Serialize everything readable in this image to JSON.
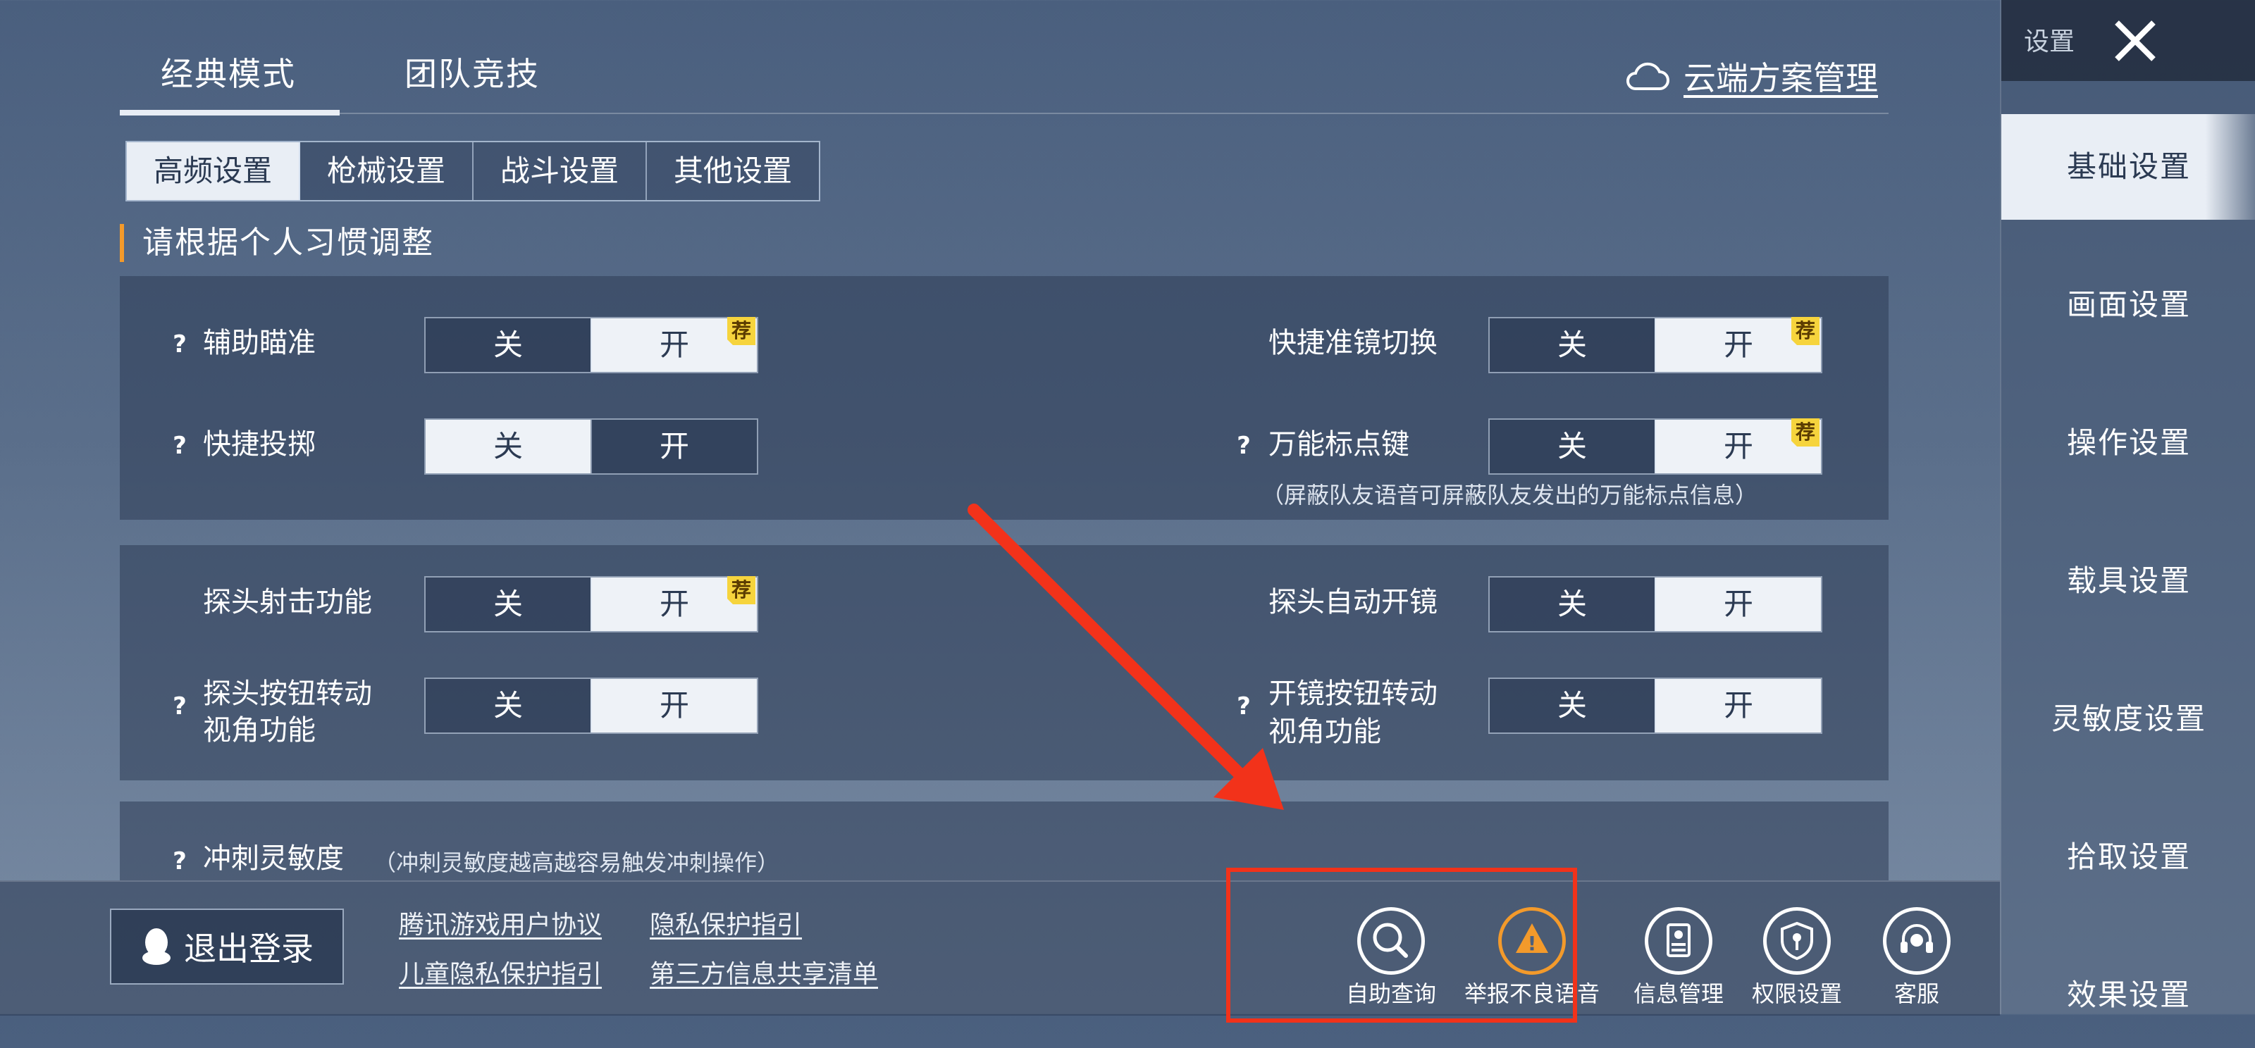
{
  "mode_tabs": [
    "经典模式",
    "团队竞技"
  ],
  "cloud_label": "云端方案管理",
  "sub_tabs": [
    "高频设置",
    "枪械设置",
    "战斗设置",
    "其他设置"
  ],
  "section_title": "请根据个人习惯调整",
  "toggle": {
    "off": "关",
    "on": "开",
    "recommended": "荐"
  },
  "settings": {
    "aim_assist": {
      "label": "辅助瞄准",
      "value": "开"
    },
    "quick_scope_switch": {
      "label": "快捷准镜切换",
      "value": "开"
    },
    "quick_throw": {
      "label": "快捷投掷",
      "value": "关"
    },
    "universal_marker": {
      "label": "万能标点键",
      "value": "开",
      "note": "（屏蔽队友语音可屏蔽队友发出的万能标点信息）"
    },
    "peek_fire": {
      "label": "探头射击功能",
      "value": "开"
    },
    "peek_auto_scope": {
      "label": "探头自动开镜",
      "value": "开"
    },
    "peek_button_rotate": {
      "label_line1": "探头按钮转动",
      "label_line2": "视角功能",
      "value": "开"
    },
    "scope_button_rotate": {
      "label_line1": "开镜按钮转动",
      "label_line2": "视角功能",
      "value": "开"
    },
    "sprint_sensitivity": {
      "label": "冲刺灵敏度",
      "note": "（冲刺灵敏度越高越容易触发冲刺操作）"
    }
  },
  "sidebar": {
    "header": "设置",
    "items": [
      "基础设置",
      "画面设置",
      "操作设置",
      "载具设置",
      "灵敏度设置",
      "拾取设置",
      "效果设置"
    ]
  },
  "bottom": {
    "logout": "退出登录",
    "links": [
      "腾讯游戏用户协议",
      "隐私保护指引",
      "儿童隐私保护指引",
      "第三方信息共享清单"
    ],
    "icons": [
      {
        "label": "自助查询",
        "icon": "search-icon"
      },
      {
        "label": "举报不良语音",
        "icon": "warning-icon"
      },
      {
        "label": "信息管理",
        "icon": "id-card-icon"
      },
      {
        "label": "权限设置",
        "icon": "shield-key-icon"
      },
      {
        "label": "客服",
        "icon": "headset-icon"
      }
    ]
  },
  "colors": {
    "accent": "#f39a2b",
    "annotation": "#f2321a",
    "recommend": "#f6d43d"
  }
}
